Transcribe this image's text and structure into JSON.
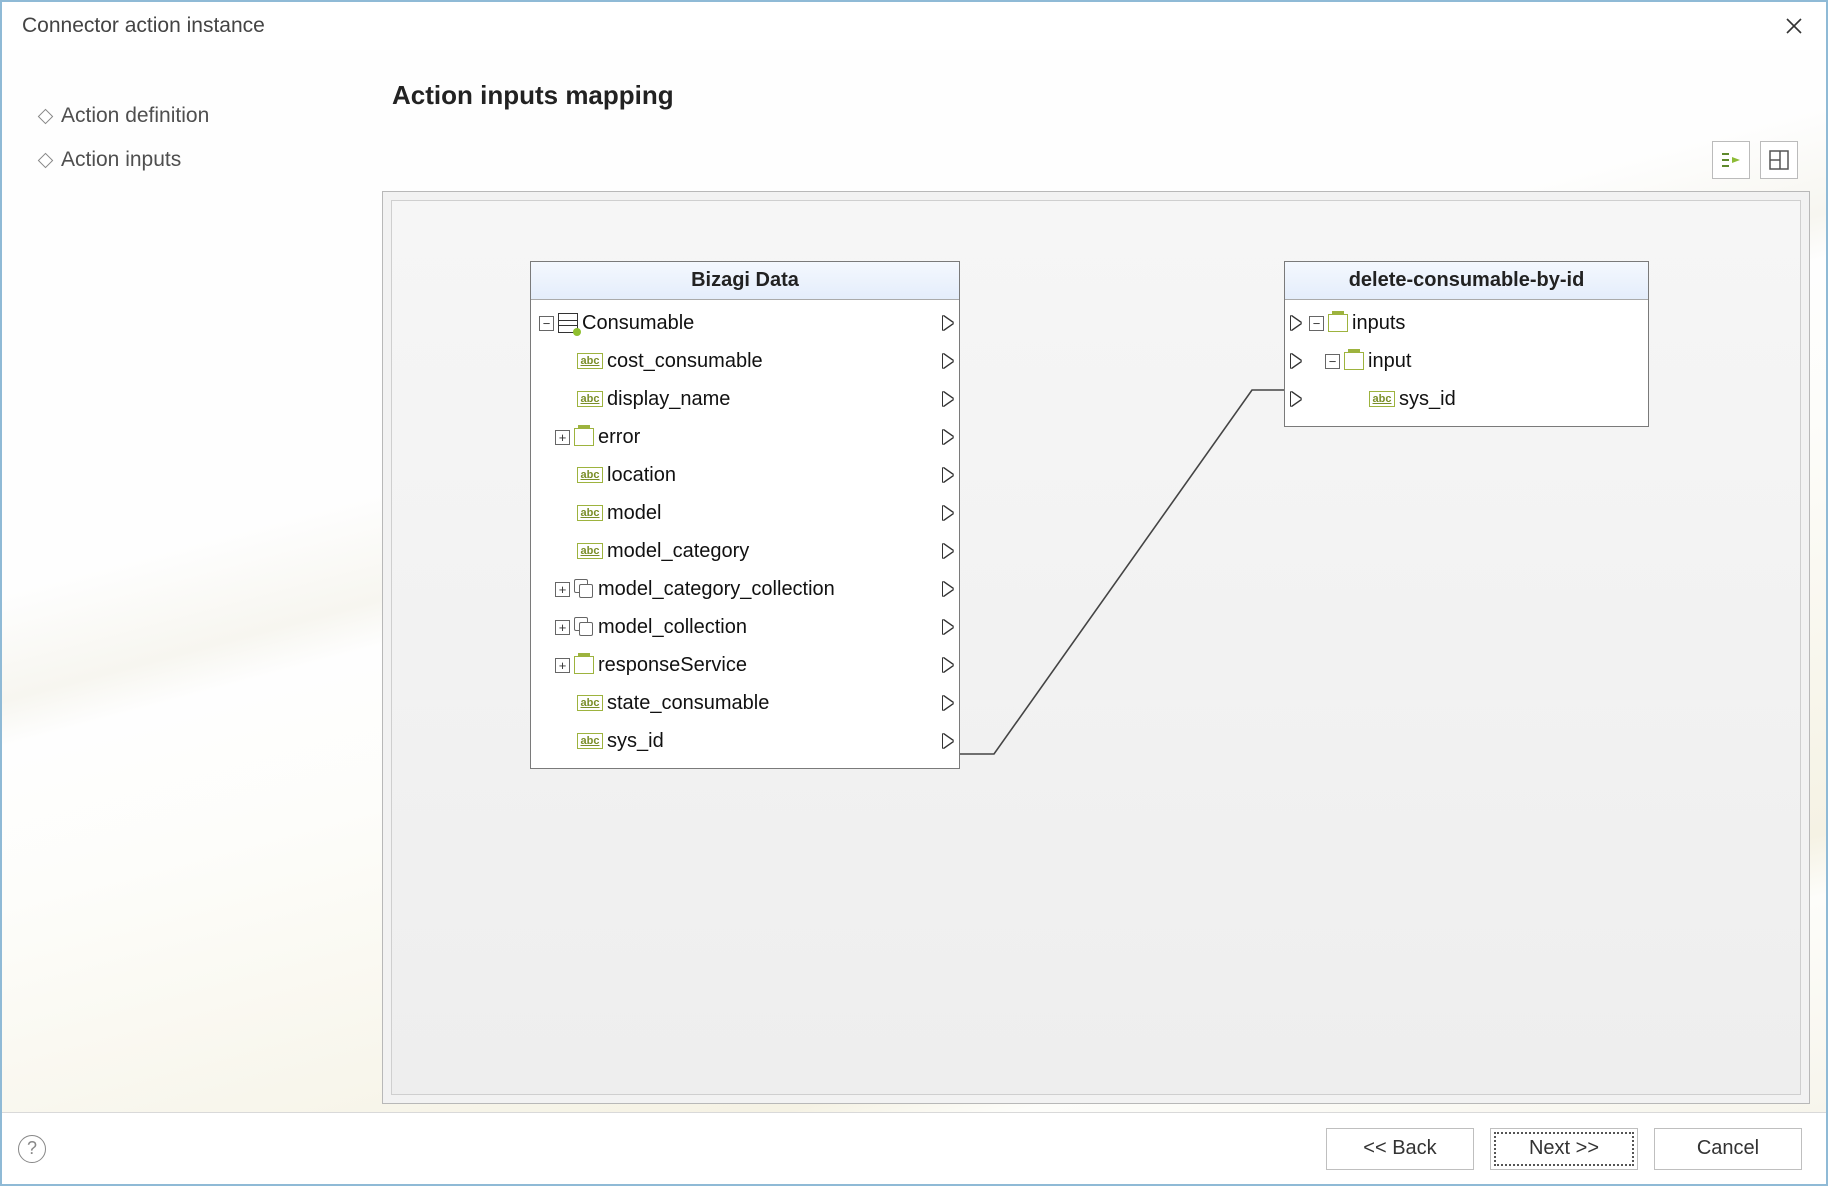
{
  "window": {
    "title": "Connector action instance"
  },
  "sidebar": {
    "items": [
      {
        "label": "Action definition"
      },
      {
        "label": "Action inputs"
      }
    ]
  },
  "heading": "Action inputs mapping",
  "left_panel": {
    "title": "Bizagi Data",
    "root": {
      "label": "Consumable",
      "node_kind": "entity",
      "expanded": true
    },
    "children": [
      {
        "label": "cost_consumable",
        "node_kind": "abc"
      },
      {
        "label": "display_name",
        "node_kind": "abc"
      },
      {
        "label": "error",
        "node_kind": "object",
        "expandable": true
      },
      {
        "label": "location",
        "node_kind": "abc"
      },
      {
        "label": "model",
        "node_kind": "abc"
      },
      {
        "label": "model_category",
        "node_kind": "abc"
      },
      {
        "label": "model_category_collection",
        "node_kind": "collection",
        "expandable": true
      },
      {
        "label": "model_collection",
        "node_kind": "collection",
        "expandable": true
      },
      {
        "label": "responseService",
        "node_kind": "object",
        "expandable": true
      },
      {
        "label": "state_consumable",
        "node_kind": "abc"
      },
      {
        "label": "sys_id",
        "node_kind": "abc"
      }
    ]
  },
  "right_panel": {
    "title": "delete-consumable-by-id",
    "nodes": [
      {
        "label": "inputs",
        "node_kind": "object",
        "level": 1,
        "expanded": true
      },
      {
        "label": "input",
        "node_kind": "object",
        "level": 2,
        "expanded": true
      },
      {
        "label": "sys_id",
        "node_kind": "abc",
        "level": 3
      }
    ]
  },
  "mapping": {
    "from": "sys_id",
    "to": "sys_id"
  },
  "footer": {
    "back_label": "<< Back",
    "next_label": "Next >>",
    "cancel_label": "Cancel"
  }
}
